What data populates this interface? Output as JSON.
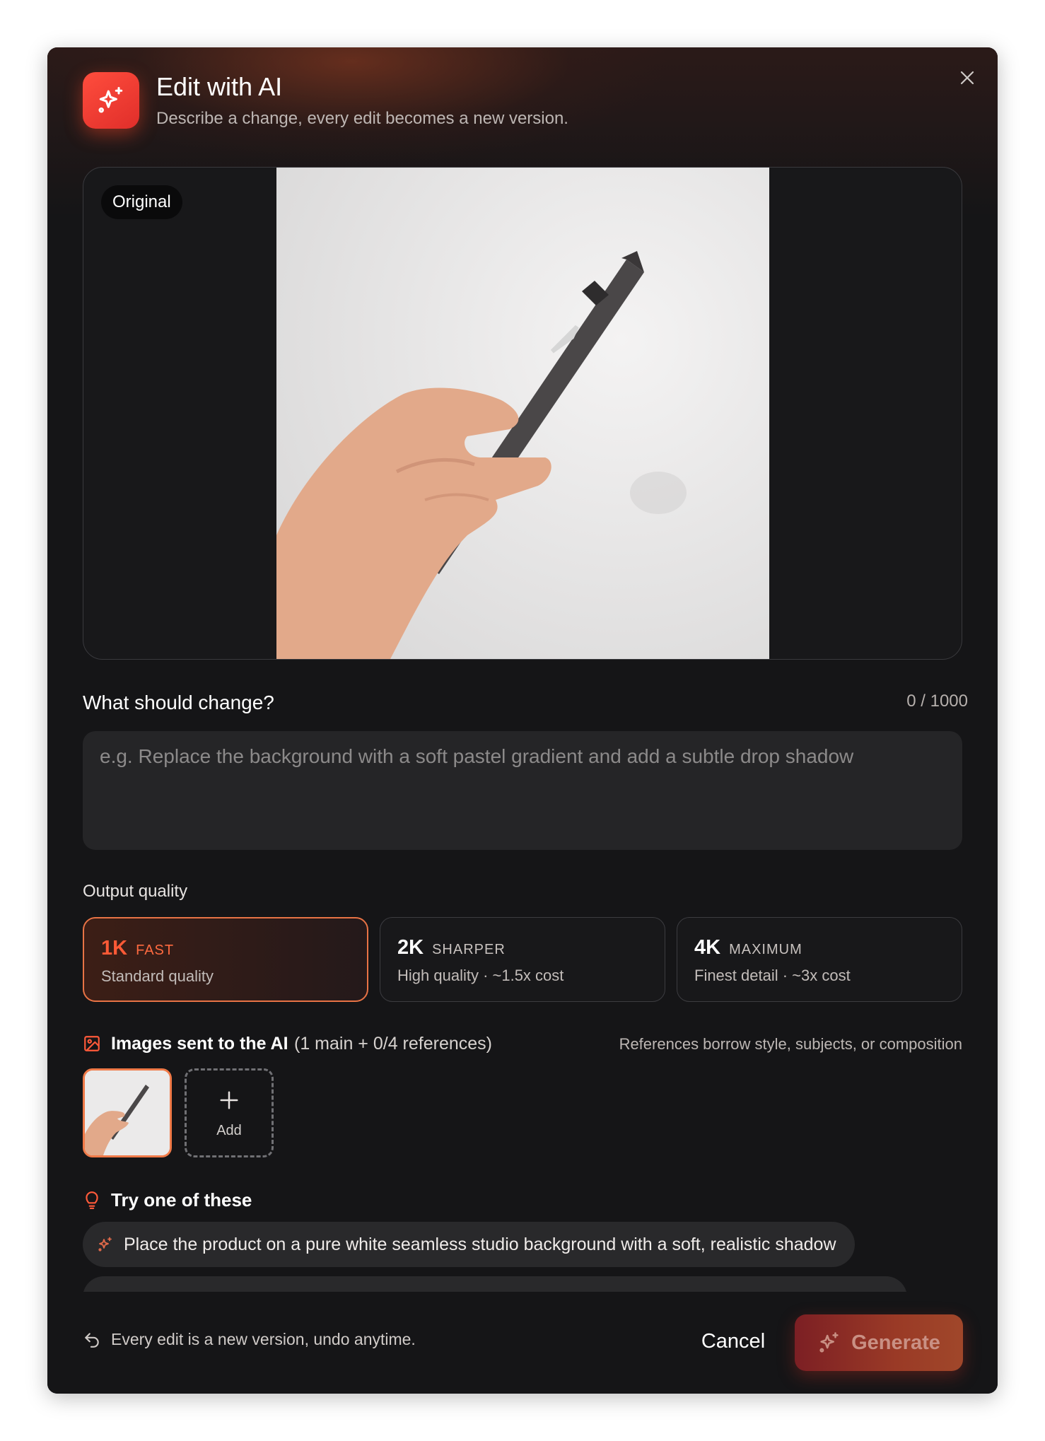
{
  "dialog": {
    "title": "Edit with AI",
    "subtitle": "Describe a change, every edit becomes a new version.",
    "close_icon": "close-icon",
    "accent_color": "#ff4d3d"
  },
  "preview": {
    "badge": "Original"
  },
  "prompt": {
    "label": "What should change?",
    "counter": "0 / 1000",
    "value": "",
    "placeholder": "e.g. Replace the background with a soft pastel gradient and add a subtle drop shadow"
  },
  "quality": {
    "label": "Output quality",
    "options": [
      {
        "main": "1K",
        "tag": "FAST",
        "desc": "Standard quality",
        "selected": true
      },
      {
        "main": "2K",
        "tag": "SHARPER",
        "desc": "High quality · ~1.5x cost",
        "selected": false
      },
      {
        "main": "4K",
        "tag": "MAXIMUM",
        "desc": "Finest detail · ~3x cost",
        "selected": false
      }
    ]
  },
  "images": {
    "title": "Images sent to the AI",
    "count": "(1 main + 0/4 references)",
    "hint": "References borrow style, subjects, or composition",
    "add_label": "Add"
  },
  "suggestions": {
    "title": "Try one of these",
    "items": [
      "Place the product on a pure white seamless studio background with a soft, realistic shadow"
    ]
  },
  "footer": {
    "note": "Every edit is a new version, undo anytime.",
    "cancel_label": "Cancel",
    "generate_label": "Generate"
  }
}
